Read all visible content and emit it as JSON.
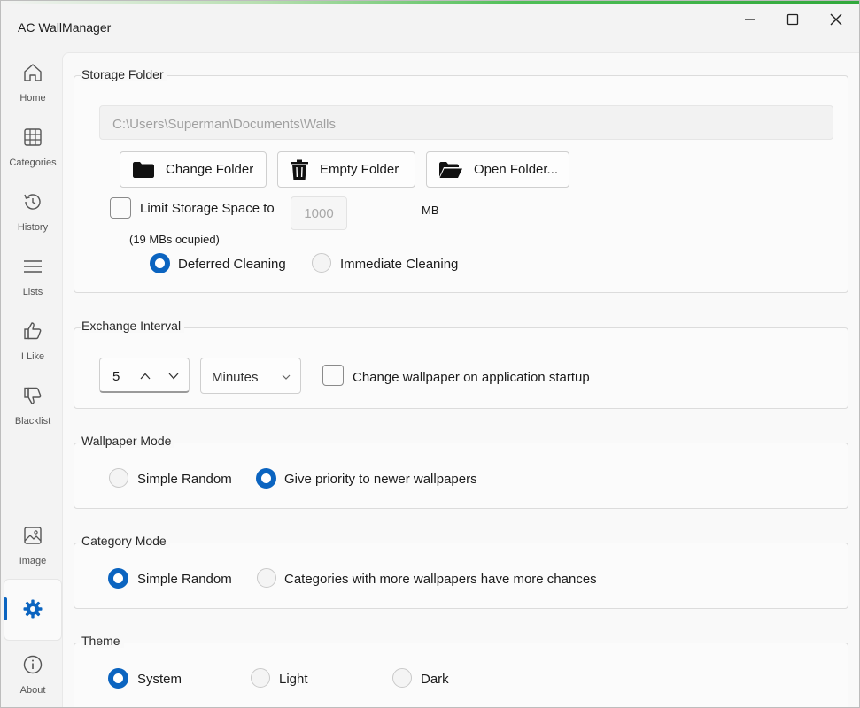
{
  "app": {
    "title": "AC WallManager"
  },
  "colors": {
    "accent": "#0b64c0",
    "accent_green": "#30a83b"
  },
  "sidebar": {
    "items": [
      {
        "label": "Home",
        "icon": "home-icon"
      },
      {
        "label": "Categories",
        "icon": "grid-icon"
      },
      {
        "label": "History",
        "icon": "history-icon"
      },
      {
        "label": "Lists",
        "icon": "list-icon"
      },
      {
        "label": "I Like",
        "icon": "thumbs-up-icon"
      },
      {
        "label": "Blacklist",
        "icon": "thumbs-down-icon"
      }
    ],
    "bottom_items": [
      {
        "label": "Image",
        "icon": "image-icon"
      },
      {
        "label": "",
        "icon": "gear-icon",
        "active": true
      },
      {
        "label": "About",
        "icon": "info-icon"
      }
    ]
  },
  "storage": {
    "label": "Storage Folder",
    "path": "C:\\Users\\Superman\\Documents\\Walls",
    "buttons": {
      "change": "Change Folder",
      "empty": "Empty Folder",
      "open": "Open Folder..."
    },
    "limit_label": "Limit Storage Space to",
    "limit_value": "1000",
    "limit_unit": "MB",
    "occupied": "(19 MBs ocupied)",
    "cleaning": {
      "deferred": "Deferred Cleaning",
      "immediate": "Immediate Cleaning",
      "selected": "deferred"
    }
  },
  "exchange": {
    "label": "Exchange Interval",
    "interval_value": "5",
    "unit_selected": "Minutes",
    "startup_label": "Change wallpaper on application startup"
  },
  "wallpaper_mode": {
    "label": "Wallpaper Mode",
    "options": [
      "Simple Random",
      "Give priority to newer wallpapers"
    ],
    "selected": 1
  },
  "category_mode": {
    "label": "Category Mode",
    "options": [
      "Simple Random",
      "Categories with more wallpapers have more chances"
    ],
    "selected": 0
  },
  "theme": {
    "label": "Theme",
    "options": [
      "System",
      "Light",
      "Dark"
    ],
    "selected": 0
  }
}
